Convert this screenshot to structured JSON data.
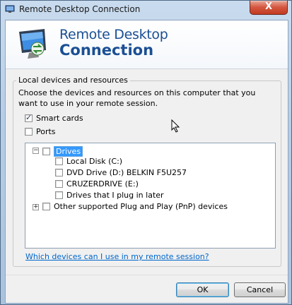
{
  "window": {
    "title": "Remote Desktop Connection",
    "close_label": "X"
  },
  "banner": {
    "line1": "Remote Desktop",
    "line2": "Connection"
  },
  "group": {
    "legend": "Local devices and resources",
    "description": "Choose the devices and resources on this computer that you want to use in your remote session."
  },
  "options": [
    {
      "label": "Smart cards",
      "checked": true
    },
    {
      "label": "Ports",
      "checked": false
    }
  ],
  "tree": {
    "drives": {
      "label": "Drives",
      "expanded": true,
      "checked": false,
      "selected": true,
      "children": [
        {
          "label": "Local Disk (C:)",
          "checked": false
        },
        {
          "label": "DVD Drive (D:) BELKIN F5U257",
          "checked": false
        },
        {
          "label": "CRUZERDRIVE (E:)",
          "checked": false
        },
        {
          "label": "Drives that I plug in later",
          "checked": false
        }
      ]
    },
    "pnp": {
      "label": "Other supported Plug and Play (PnP) devices",
      "expanded": false,
      "checked": false
    }
  },
  "help_link": "Which devices can I use in my remote session?",
  "buttons": {
    "ok": "OK",
    "cancel": "Cancel"
  },
  "icons": {
    "title": "remote-desktop-icon",
    "logo": "remote-desktop-monitor-icon",
    "cursor": "mouse-pointer-icon"
  },
  "colors": {
    "accent": "#1a4f94",
    "link": "#0066cc",
    "selection": "#3399ff"
  }
}
